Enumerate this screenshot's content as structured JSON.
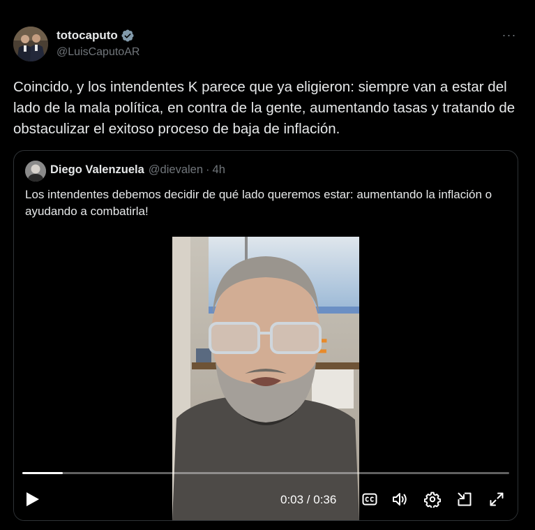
{
  "author": {
    "display_name": "totocaputo",
    "handle": "@LuisCaputoAR",
    "verified": true
  },
  "tweet": {
    "text": "Coincido, y los intendentes K parece que ya eligieron: siempre van a estar del lado de la mala política, en contra de la gente, aumentando tasas y tratando de obstaculizar el exitoso proceso de baja de inflación."
  },
  "more_label": "···",
  "quote": {
    "display_name": "Diego Valenzuela",
    "handle": "@dievalen",
    "separator": "·",
    "time": "4h",
    "text": "Los intendentes debemos decidir de qué lado queremos estar: aumentando la inflación o ayudando a combatirla!"
  },
  "video": {
    "current_time": "0:03",
    "duration": "0:36",
    "time_display": "0:03 / 0:36",
    "progress_fraction": 0.0833
  },
  "colors": {
    "background": "#000000",
    "text_primary": "#e7e9ea",
    "text_secondary": "#71767b",
    "border": "#2f3336",
    "verified_badge": "#829aab"
  },
  "icons": {
    "verified": "verified-badge-icon",
    "more": "more-options-icon",
    "play": "play-icon",
    "captions": "captions-icon",
    "volume": "volume-icon",
    "settings": "settings-gear-icon",
    "pip": "picture-in-picture-icon",
    "fullscreen": "fullscreen-icon"
  }
}
